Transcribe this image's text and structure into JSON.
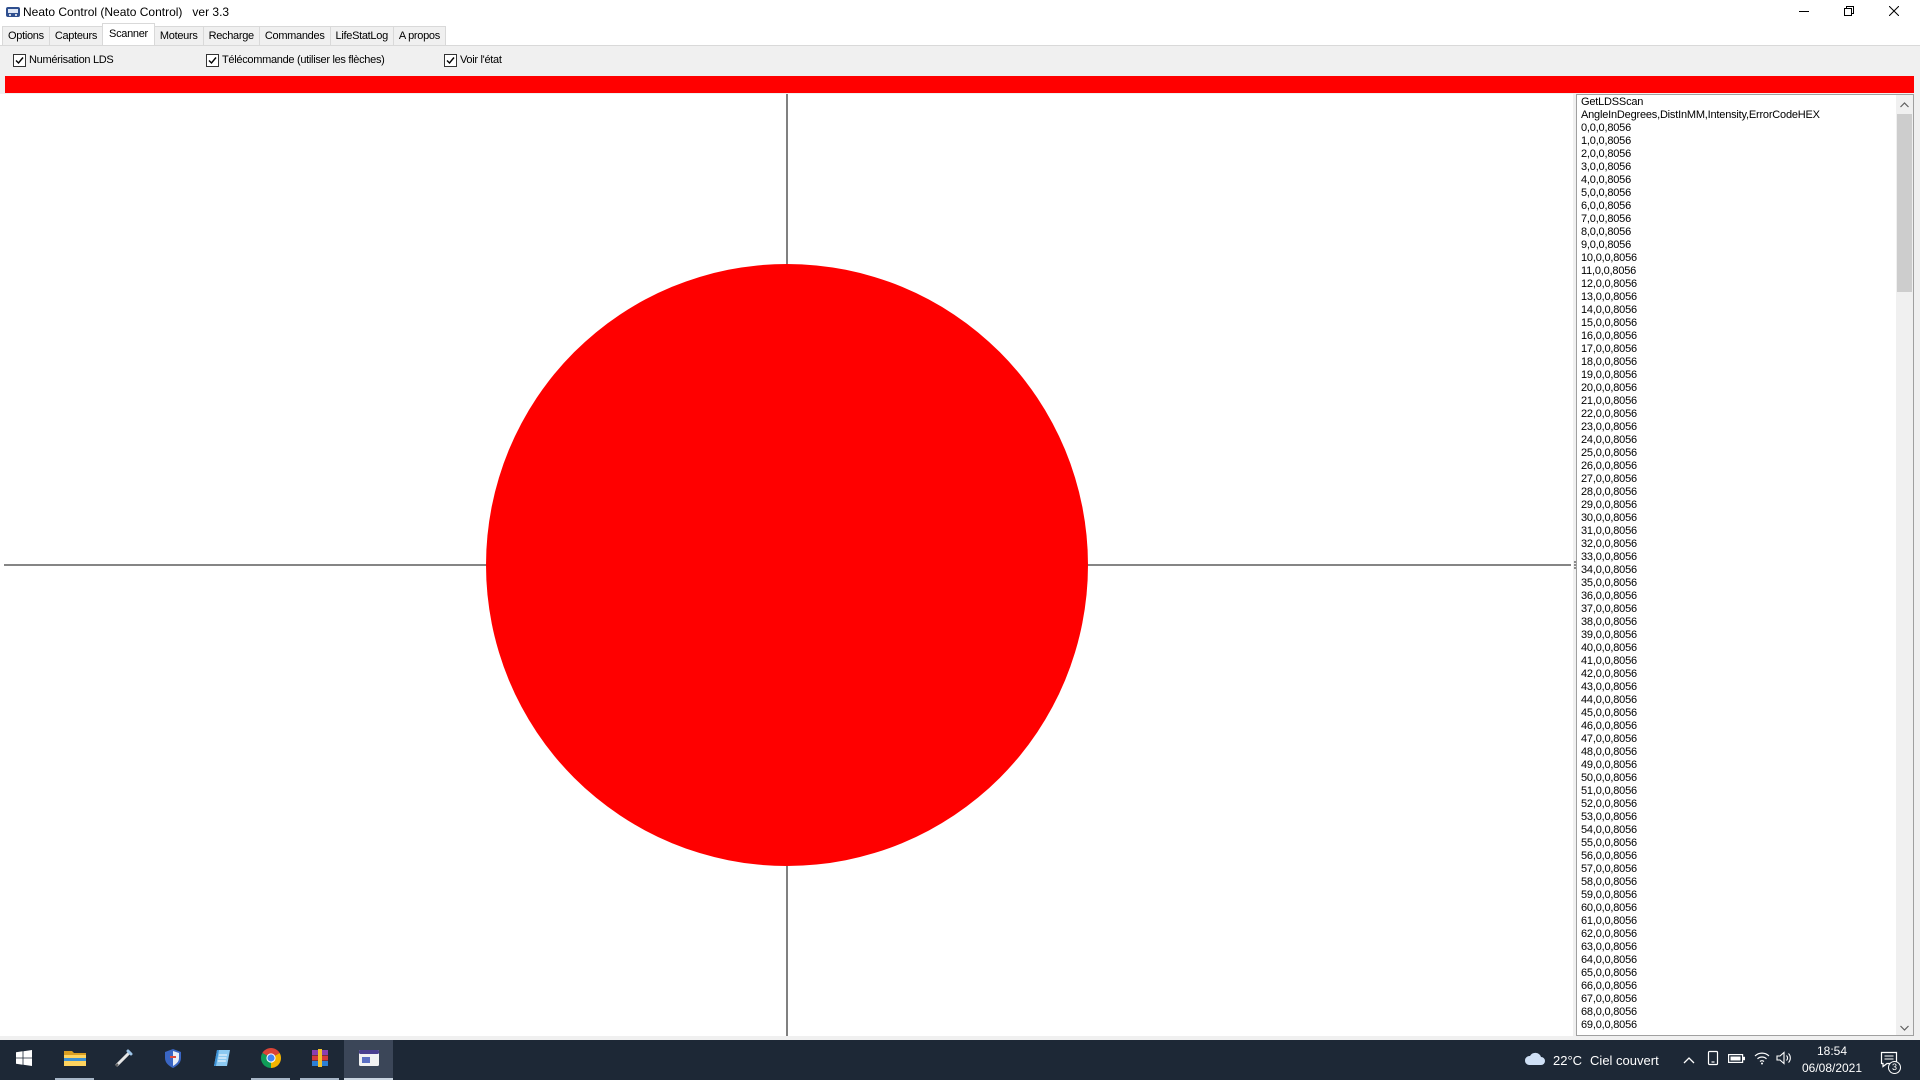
{
  "window": {
    "title": "Neato Control (Neato Control)   ver 3.3",
    "app_icon": "neato-app-icon",
    "controls": {
      "minimize": "minimize-icon",
      "restore": "restore-icon",
      "close": "close-icon"
    }
  },
  "tabs": [
    {
      "label": "Options"
    },
    {
      "label": "Capteurs"
    },
    {
      "label": "Scanner"
    },
    {
      "label": "Moteurs"
    },
    {
      "label": "Recharge"
    },
    {
      "label": "Commandes"
    },
    {
      "label": "LifeStatLog"
    },
    {
      "label": "A propos"
    }
  ],
  "selected_tab": "Scanner",
  "scanner": {
    "options": [
      {
        "label": "Numérisation LDS",
        "checked": true
      },
      {
        "label": "Télécommande (utiliser les flèches)",
        "checked": true
      },
      {
        "label": "Voir l'état",
        "checked": true
      }
    ],
    "status_color": "#ff0000",
    "plot": {
      "marker_color": "#ff0000",
      "axis_color": "#3c3c3c"
    },
    "output_lines": [
      "GetLDSScan",
      "AngleInDegrees,DistInMM,Intensity,ErrorCodeHEX",
      "0,0,0,8056",
      "1,0,0,8056",
      "2,0,0,8056",
      "3,0,0,8056",
      "4,0,0,8056",
      "5,0,0,8056",
      "6,0,0,8056",
      "7,0,0,8056",
      "8,0,0,8056",
      "9,0,0,8056",
      "10,0,0,8056",
      "11,0,0,8056",
      "12,0,0,8056",
      "13,0,0,8056",
      "14,0,0,8056",
      "15,0,0,8056",
      "16,0,0,8056",
      "17,0,0,8056",
      "18,0,0,8056",
      "19,0,0,8056",
      "20,0,0,8056",
      "21,0,0,8056",
      "22,0,0,8056",
      "23,0,0,8056",
      "24,0,0,8056",
      "25,0,0,8056",
      "26,0,0,8056",
      "27,0,0,8056",
      "28,0,0,8056",
      "29,0,0,8056",
      "30,0,0,8056",
      "31,0,0,8056",
      "32,0,0,8056",
      "33,0,0,8056",
      "34,0,0,8056",
      "35,0,0,8056",
      "36,0,0,8056",
      "37,0,0,8056",
      "38,0,0,8056",
      "39,0,0,8056",
      "40,0,0,8056",
      "41,0,0,8056",
      "42,0,0,8056",
      "43,0,0,8056",
      "44,0,0,8056",
      "45,0,0,8056",
      "46,0,0,8056",
      "47,0,0,8056",
      "48,0,0,8056",
      "49,0,0,8056",
      "50,0,0,8056",
      "51,0,0,8056",
      "52,0,0,8056",
      "53,0,0,8056",
      "54,0,0,8056",
      "55,0,0,8056",
      "56,0,0,8056",
      "57,0,0,8056",
      "58,0,0,8056",
      "59,0,0,8056",
      "60,0,0,8056",
      "61,0,0,8056",
      "62,0,0,8056",
      "63,0,0,8056",
      "64,0,0,8056",
      "65,0,0,8056",
      "66,0,0,8056",
      "67,0,0,8056",
      "68,0,0,8056",
      "69,0,0,8056"
    ]
  },
  "taskbar": {
    "start_icon": "windows-start-icon",
    "apps": [
      {
        "icon": "file-explorer-icon",
        "running": true,
        "active": false
      },
      {
        "icon": "pen-tool-icon",
        "running": false,
        "active": false
      },
      {
        "icon": "security-shield-icon",
        "running": false,
        "active": false
      },
      {
        "icon": "notebook-icon",
        "running": false,
        "active": false
      },
      {
        "icon": "chrome-icon",
        "running": true,
        "active": false
      },
      {
        "icon": "archive-icon",
        "running": true,
        "active": false
      },
      {
        "icon": "neato-control-icon",
        "running": true,
        "active": true
      }
    ],
    "weather": {
      "icon": "cloudy-weather-icon",
      "temperature": "22°C",
      "condition": "Ciel couvert"
    },
    "tray": {
      "overflow_icon": "chevron-up-icon",
      "icons": [
        "tablet-icon",
        "battery-icon",
        "wifi-icon",
        "volume-icon"
      ]
    },
    "clock": {
      "time": "18:54",
      "date": "06/08/2021"
    },
    "notifications": {
      "icon": "action-center-icon",
      "count": "3"
    }
  },
  "colors": {
    "taskbar": "#1d2836",
    "window": "#f0f0f0",
    "status_red": "#ff0000"
  }
}
